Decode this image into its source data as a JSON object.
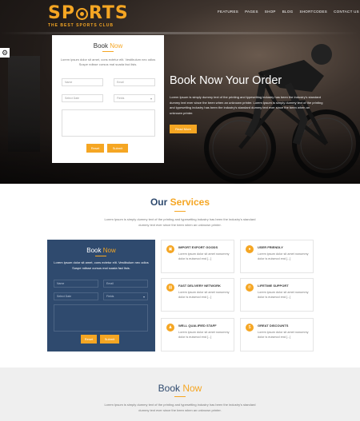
{
  "logo": {
    "brand_part1": "SP",
    "brand_part2": "RTS",
    "tagline": "THE BEST SPORTS CLUB"
  },
  "nav": [
    "FEATURES",
    "PAGES",
    "SHOP",
    "BLOG",
    "SHORTCODES",
    "CONTACT US"
  ],
  "hero": {
    "headline": "Book Now Your Order",
    "text": "Lorem Ipsum is simply dummy text of the printing and typesetting industry has been the industry's standard dummy text ever since the been when an unknown printer. Lorem Ipsum is simply dummy text of the printing and typesetting industry has been the industry's standard dummy text ever since the been when an unknown printer.",
    "button": "Read More"
  },
  "book_form": {
    "title_part1": "Book ",
    "title_part2": "Now",
    "desc": "Lorem ipsum dolor sit amet, cons ectetur elit. Vestibulum nec odios Suspe ndisse cursus mal suada faci lisis.",
    "name_placeholder": "Name",
    "email_placeholder": "Email",
    "date_placeholder": "Select Date",
    "select_value": "Fields",
    "reset_label": "Reset",
    "submit_label": "Submit"
  },
  "services": {
    "title_part1": "Our ",
    "title_part2": "Services",
    "desc": "Lorem Ipsum is simply dummy text of the printing and typesetting industry has been the industry's standard dummy text ever since the been when an unknown printer.",
    "items": [
      {
        "title": "IMPORT EXPORT GOODS",
        "desc": "Lorem ipsum dolor sit amet nonummy dolor is euismod end [...]"
      },
      {
        "title": "USER FRIENDLY",
        "desc": "Lorem ipsum dolor sit amet nonummy dolor is euismod end [...]"
      },
      {
        "title": "FAST DELIVERY NETWORK",
        "desc": "Lorem ipsum dolor sit amet nonummy dolor is euismod end [...]"
      },
      {
        "title": "LIFETIME SUPPORT",
        "desc": "Lorem ipsum dolor sit amet nonummy dolor is euismod end [...]"
      },
      {
        "title": "WELL QUALIFIED STAFF",
        "desc": "Lorem ipsum dolor sit amet nonummy dolor is euismod end [...]"
      },
      {
        "title": "GREAT DISCOUNTS",
        "desc": "Lorem ipsum dolor sit amet nonummy dolor is euismod end [...]"
      }
    ]
  },
  "dark_form": {
    "title_part1": "Book ",
    "title_part2": "Now",
    "desc": "Lorem ipsum dolor sit amet, cons ectetur elit. Vestibulum nec odios Suspe ndisse cursus mal suada faci lisis.",
    "name_placeholder": "Name",
    "email_placeholder": "Email",
    "date_placeholder": "Select Date",
    "select_value": "Fields",
    "reset_label": "Reset",
    "submit_label": "Submit"
  },
  "book_section": {
    "title_part1": "Book ",
    "title_part2": "Now",
    "desc": "Lorem Ipsum is simply dummy text of the printing and typesetting industry has been the industry's standard dummy text ever since the been when an unknown printer."
  },
  "colors": {
    "accent": "#f5a623",
    "navy": "#2f4a6e"
  }
}
